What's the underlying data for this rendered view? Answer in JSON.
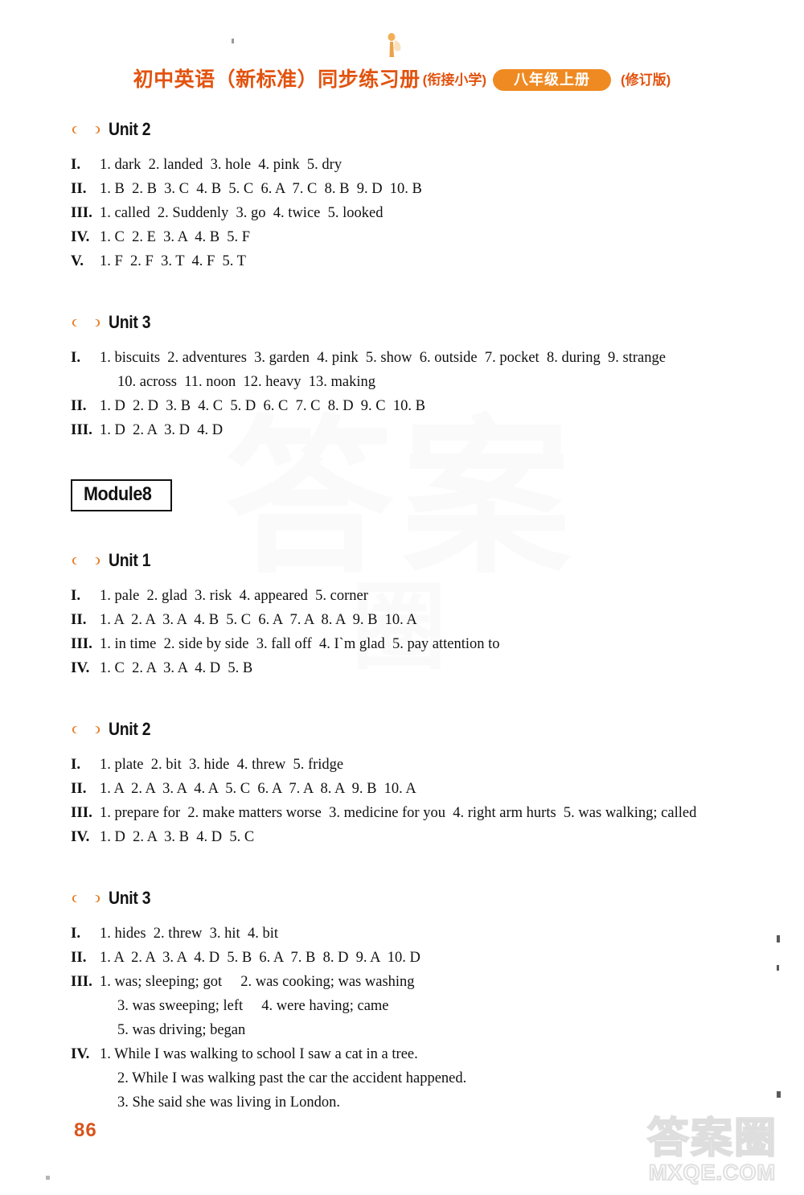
{
  "header": {
    "title_main": "初中英语（新标准）同步练习册",
    "title_sub": "(衔接小学)",
    "badge": "八年级上册",
    "revision": "(修订版)"
  },
  "page_number": "86",
  "watermark": {
    "chinese": "答案圈",
    "url": "MXQE.COM",
    "background_line1": "答案",
    "background_line2": "圈"
  },
  "sections": [
    {
      "kind": "unit",
      "heading": "Unit 2",
      "rows": [
        {
          "num": "I.",
          "text": "1. dark  2. landed  3. hole  4. pink  5. dry"
        },
        {
          "num": "II.",
          "text": "1. B  2. B  3. C  4. B  5. C  6. A  7. C  8. B  9. D  10. B"
        },
        {
          "num": "III.",
          "text": "1. called  2. Suddenly  3. go  4. twice  5. looked"
        },
        {
          "num": "IV.",
          "text": "1. C  2. E  3. A  4. B  5. F"
        },
        {
          "num": "V.",
          "text": "1. F  2. F  3. T  4. F  5. T"
        }
      ]
    },
    {
      "kind": "unit",
      "heading": "Unit 3",
      "rows": [
        {
          "num": "I.",
          "text": "1. biscuits  2. adventures  3. garden  4. pink  5. show  6. outside  7. pocket  8. during  9. strange"
        },
        {
          "num": "",
          "text": "10. across  11. noon  12. heavy  13. making",
          "continuation": true
        },
        {
          "num": "II.",
          "text": "1. D  2. D  3. B  4. C  5. D  6. C  7. C  8. D  9. C  10. B"
        },
        {
          "num": "III.",
          "text": "1. D  2. A  3. D  4. D"
        }
      ]
    },
    {
      "kind": "module",
      "heading": "Module8"
    },
    {
      "kind": "unit",
      "heading": "Unit 1",
      "rows": [
        {
          "num": "I.",
          "text": "1. pale  2. glad  3. risk  4. appeared  5. corner"
        },
        {
          "num": "II.",
          "text": "1. A  2. A  3. A  4. B  5. C  6. A  7. A  8. A  9. B  10. A"
        },
        {
          "num": "III.",
          "text": "1. in time  2. side by side  3. fall off  4. I`m glad  5. pay attention to"
        },
        {
          "num": "IV.",
          "text": "1. C  2. A  3. A  4. D  5. B"
        }
      ]
    },
    {
      "kind": "unit",
      "heading": "Unit 2",
      "rows": [
        {
          "num": "I.",
          "text": "1. plate  2. bit  3. hide  4. threw  5. fridge"
        },
        {
          "num": "II.",
          "text": "1. A  2. A  3. A  4. A  5. C  6. A  7. A  8. A  9. B  10. A"
        },
        {
          "num": "III.",
          "text": "1. prepare for  2. make matters worse  3. medicine for you  4. right arm hurts  5. was walking; called"
        },
        {
          "num": "IV.",
          "text": "1. D  2. A  3. B  4. D  5. C"
        }
      ]
    },
    {
      "kind": "unit",
      "heading": "Unit 3",
      "rows": [
        {
          "num": "I.",
          "text": "1. hides  2. threw  3. hit  4. bit"
        },
        {
          "num": "II.",
          "text": "1. A  2. A  3. A  4. D  5. B  6. A  7. B  8. D  9. A  10. D"
        },
        {
          "num": "III.",
          "text": "1. was; sleeping; got     2. was cooking; was washing"
        },
        {
          "num": "",
          "text": "3. was sweeping; left     4. were having; came",
          "continuation": true
        },
        {
          "num": "",
          "text": "5. was driving; began",
          "continuation": true
        },
        {
          "num": "IV.",
          "text": "1. While I was walking to school I saw a cat in a tree."
        },
        {
          "num": "",
          "text": "2. While I was walking past the car the accident happened.",
          "continuation": true
        },
        {
          "num": "",
          "text": "3. She said she was living in London.",
          "continuation": true
        }
      ]
    }
  ]
}
